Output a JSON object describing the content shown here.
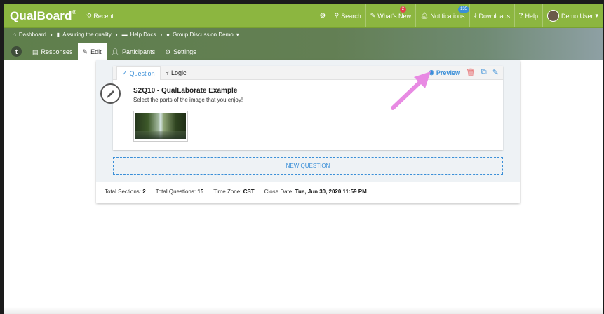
{
  "brand": {
    "name": "QualBoard",
    "mark": "®"
  },
  "topbar": {
    "recent": "Recent",
    "search": "Search",
    "whats_new": "What's New",
    "whats_new_badge": "2",
    "notifications": "Notifications",
    "notifications_badge": "135",
    "downloads": "Downloads",
    "help": "Help",
    "user": "Demo User"
  },
  "breadcrumb": [
    "Dashboard",
    "Assuring the quality",
    "Help Docs",
    "Group Discussion Demo"
  ],
  "tabs": {
    "back": "t",
    "responses": "Responses",
    "edit": "Edit",
    "participants": "Participants",
    "settings": "Settings"
  },
  "question_card": {
    "tab_question": "Question",
    "tab_logic": "Logic",
    "preview": "Preview",
    "title": "S2Q10 - QualLaborate Example",
    "description": "Select the parts of the image that you enjoy!"
  },
  "new_question": "NEW QUESTION",
  "stats": {
    "sections_label": "Total Sections:",
    "sections_value": "2",
    "questions_label": "Total Questions:",
    "questions_value": "15",
    "timezone_label": "Time Zone:",
    "timezone_value": "CST",
    "close_label": "Close Date:",
    "close_value": "Tue, Jun 30, 2020 11:59 PM"
  },
  "colors": {
    "brand_green": "#8cb640",
    "accent_blue": "#3a8fd8",
    "annotation_arrow": "#e88ae3"
  }
}
